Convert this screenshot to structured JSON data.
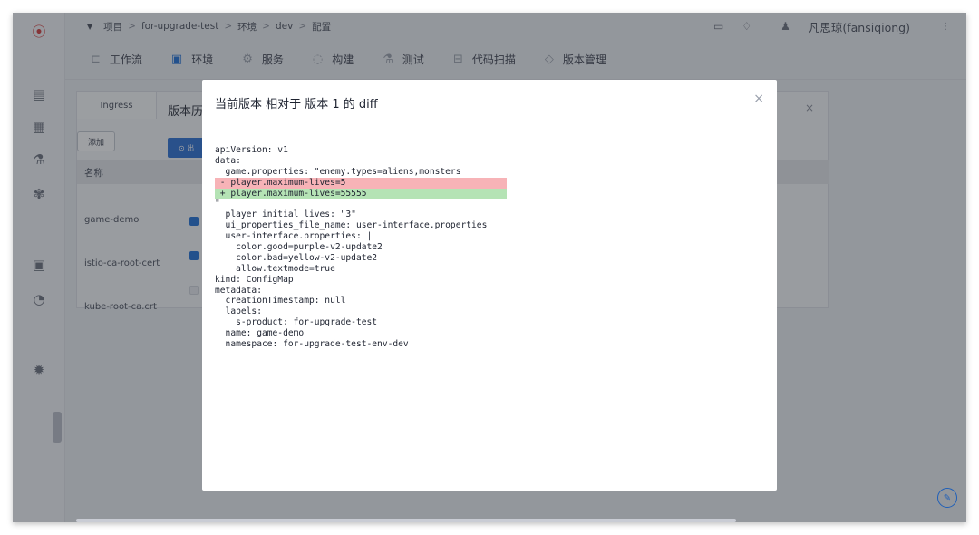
{
  "breadcrumb": [
    "项目",
    "for-upgrade-test",
    "环境",
    "dev",
    "配置"
  ],
  "user": {
    "name": "凡思琼(fansiqiong)"
  },
  "nav_tabs": [
    {
      "label": "工作流",
      "icon": "workflow-icon"
    },
    {
      "label": "环境",
      "icon": "environment-icon",
      "active": true
    },
    {
      "label": "服务",
      "icon": "service-icon"
    },
    {
      "label": "构建",
      "icon": "build-icon"
    },
    {
      "label": "测试",
      "icon": "test-icon"
    },
    {
      "label": "代码扫描",
      "icon": "code-scan-icon"
    },
    {
      "label": "版本管理",
      "icon": "version-icon"
    }
  ],
  "background": {
    "tab_label": "Ingress",
    "add_label": "添加",
    "name_header": "名称",
    "rows": [
      "game-demo",
      "istio-ca-root-cert",
      "kube-root-ca.crt"
    ],
    "history_title": "版本历",
    "history_button": "⊙ 出",
    "history_close": "×"
  },
  "modal": {
    "title": "当前版本 相对于 版本 1 的 diff",
    "close": "×",
    "lines": [
      {
        "t": "apiVersion: v1",
        "k": "ctx"
      },
      {
        "t": "data:",
        "k": "ctx"
      },
      {
        "t": "  game.properties: \"enemy.types=aliens,monsters",
        "k": "ctx"
      },
      {
        "t": " - player.maximum-lives=5",
        "k": "del"
      },
      {
        "t": " + player.maximum-lives=55555",
        "k": "add"
      },
      {
        "t": "\"",
        "k": "ctx"
      },
      {
        "t": "  player_initial_lives: \"3\"",
        "k": "ctx"
      },
      {
        "t": "  ui_properties_file_name: user-interface.properties",
        "k": "ctx"
      },
      {
        "t": "  user-interface.properties: |",
        "k": "ctx"
      },
      {
        "t": "    color.good=purple-v2-update2",
        "k": "ctx"
      },
      {
        "t": "    color.bad=yellow-v2-update2",
        "k": "ctx"
      },
      {
        "t": "    allow.textmode=true",
        "k": "ctx"
      },
      {
        "t": "kind: ConfigMap",
        "k": "ctx"
      },
      {
        "t": "metadata:",
        "k": "ctx"
      },
      {
        "t": "  creationTimestamp: null",
        "k": "ctx"
      },
      {
        "t": "  labels:",
        "k": "ctx"
      },
      {
        "t": "    s-product: for-upgrade-test",
        "k": "ctx"
      },
      {
        "t": "  name: game-demo",
        "k": "ctx"
      },
      {
        "t": "  namespace: for-upgrade-test-env-dev",
        "k": "ctx"
      }
    ]
  },
  "colors": {
    "accent": "#1f6fd6",
    "diff_del": "#f7b3b7",
    "diff_add": "#b5e3b5"
  }
}
